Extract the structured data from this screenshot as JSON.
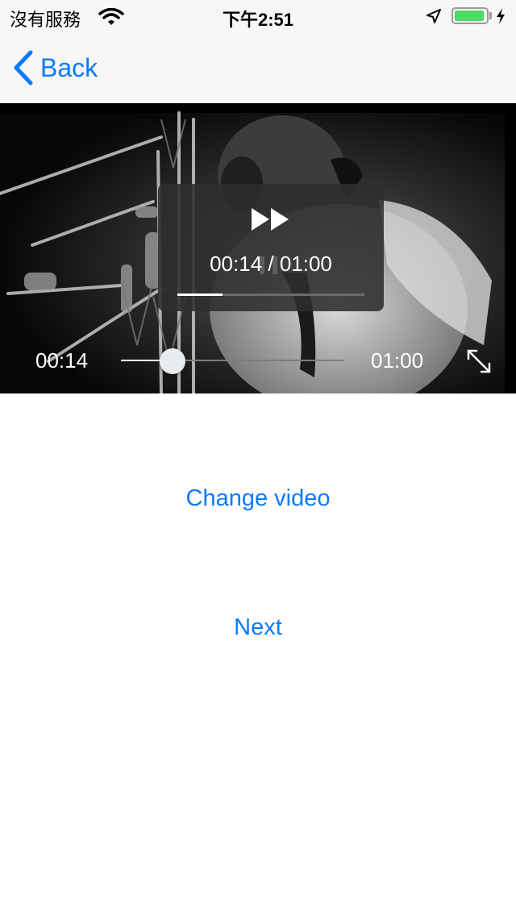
{
  "status_bar": {
    "carrier": "沒有服務",
    "time": "下午2:51",
    "battery_level": 0.95,
    "battery_color": "#4cd964",
    "icons": [
      "wifi-icon",
      "location-arrow-icon",
      "battery-icon",
      "charging-bolt-icon"
    ]
  },
  "nav": {
    "back_label": "Back",
    "accent_color": "#0a7aff"
  },
  "player": {
    "overlay_time": "00:14 / 01:00",
    "overlay_progress": 0.24,
    "current_time": "00:14",
    "total_time": "01:00",
    "progress": 0.233,
    "icons": [
      "fast-forward-icon",
      "pause-icon",
      "fullscreen-icon"
    ]
  },
  "actions": {
    "change_video": "Change video",
    "next": "Next"
  }
}
